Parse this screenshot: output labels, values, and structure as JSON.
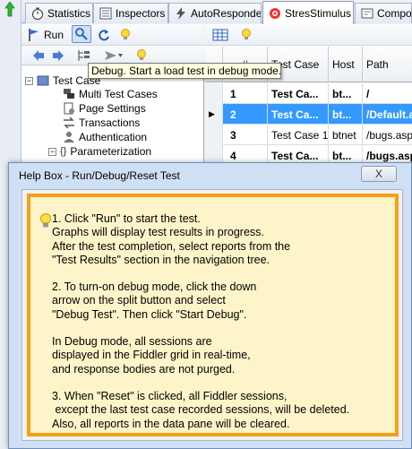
{
  "tabs": [
    {
      "label": "Statistics",
      "icon": "stopwatch-icon"
    },
    {
      "label": "Inspectors",
      "icon": "inspector-icon"
    },
    {
      "label": "AutoResponder",
      "icon": "lightning-icon"
    },
    {
      "label": "StresStimulus",
      "icon": "stresstimulus-icon"
    },
    {
      "label": "Compose",
      "icon": "compose-icon"
    }
  ],
  "toolbar": {
    "run_label": "Run"
  },
  "tooltip": "Debug. Start a load test in debug mode.",
  "tree": {
    "root_label": "Test Case",
    "items": [
      {
        "label": "Multi Test Cases",
        "icon": "multi-test-cases-icon"
      },
      {
        "label": "Page Settings",
        "icon": "page-settings-icon"
      },
      {
        "label": "Transactions",
        "icon": "transactions-icon"
      },
      {
        "label": "Authentication",
        "icon": "authentication-icon"
      },
      {
        "label": "Parameterization",
        "icon": "parameterization-icon"
      }
    ]
  },
  "grid": {
    "columns": [
      "#",
      "Test Case",
      "Host",
      "Path"
    ],
    "rows": [
      {
        "num": "1",
        "test_case": "Test Ca...",
        "host": "bt...",
        "path": "/",
        "bold": true,
        "selected": false
      },
      {
        "num": "2",
        "test_case": "Test Ca...",
        "host": "bt...",
        "path": "/Default.a",
        "bold": true,
        "selected": true
      },
      {
        "num": "3",
        "test_case": "Test Case 1",
        "host": "btnet",
        "path": "/bugs.aspx",
        "bold": false,
        "selected": false
      },
      {
        "num": "4",
        "test_case": "Test Ca...",
        "host": "bt...",
        "path": "/bugs.asp",
        "bold": true,
        "selected": false
      }
    ]
  },
  "dialog": {
    "title": "Help Box - Run/Debug/Reset Test",
    "close_label": "X",
    "lines": [
      "1. Click \"Run\" to start the test.",
      "Graphs will display test results in progress.",
      "After the test completion, select reports from the",
      "\"Test Results\" section in the navigation tree.",
      "",
      "2. To turn-on debug mode, click the down",
      "arrow on the split button and select",
      "\"Debug Test\". Then click \"Start Debug\".",
      "",
      "In Debug mode, all sessions are",
      "displayed in the Fiddler grid in real-time,",
      "and response bodies are not purged.",
      "",
      "3. When \"Reset\" is clicked, all Fiddler sessions,",
      " except the last test case recorded sessions, will be deleted.",
      "Also, all reports in the data pane will be cleared."
    ]
  },
  "colors": {
    "selected_row": "#3399ff",
    "help_border": "#f5a017",
    "help_background": "#fdf5c9",
    "dialog_frame": "#cfe0f5"
  }
}
